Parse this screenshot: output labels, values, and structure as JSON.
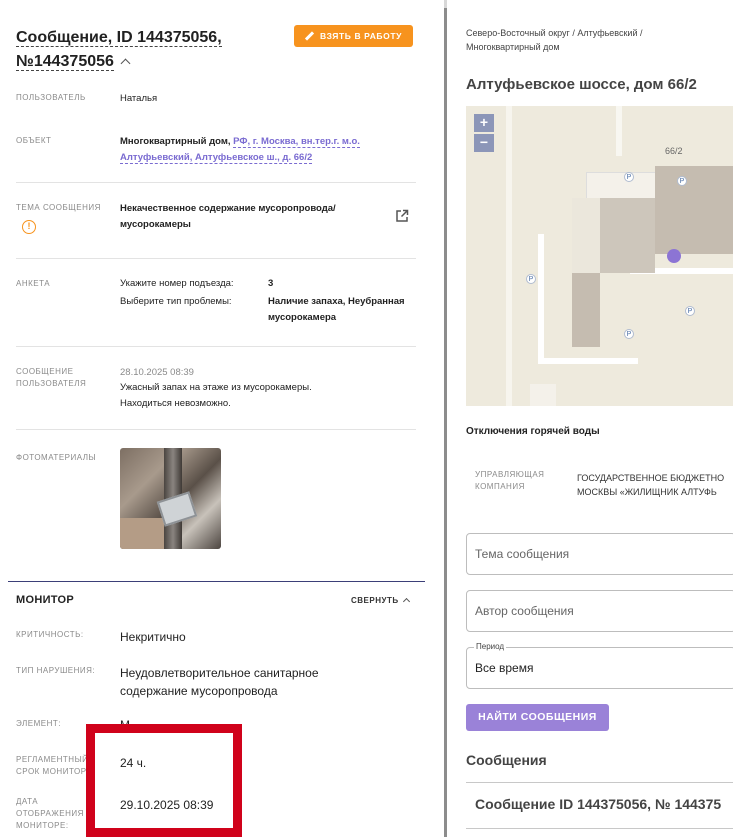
{
  "message": {
    "title_line1": "Сообщение, ID 144375056,",
    "title_line2": "№144375056",
    "take_button": "ВЗЯТЬ В РАБОТУ",
    "fields": {
      "user_label": "ПОЛЬЗОВАТЕЛЬ",
      "user_value": "Наталья",
      "object_label": "ОБЪЕКТ",
      "object_prefix": "Многоквартирный дом, ",
      "object_link_1": "РФ, г. Москва, вн.тер.г. м.о.",
      "object_link_2": "Алтуфьевский, Алтуфьевское ш., д. 66/2",
      "topic_label": "ТЕМА СООБЩЕНИЯ",
      "topic_value_1": "Некачественное содержание мусоропровода/",
      "topic_value_2": "мусорокамеры",
      "survey_label": "АНКЕТА",
      "survey_q1": "Укажите номер подъезда:",
      "survey_a1": "3",
      "survey_q2": "Выберите тип проблемы:",
      "survey_a2_1": "Наличие запаха, Неубранная",
      "survey_a2_2": "мусорокамера",
      "user_msg_label_1": "СООБЩЕНИЕ",
      "user_msg_label_2": "ПОЛЬЗОВАТЕЛЯ",
      "user_msg_date": "28.10.2025 08:39",
      "user_msg_text_1": "Ужасный запах на этаже из мусорокамеры.",
      "user_msg_text_2": "Находиться невозможно.",
      "photos_label": "ФОТОМАТЕРИАЛЫ"
    }
  },
  "monitor": {
    "title": "МОНИТОР",
    "collapse": "СВЕРНУТЬ",
    "criticality_label": "КРИТИЧНОСТЬ:",
    "criticality_value": "Некритично",
    "violation_label": "ТИП НАРУШЕНИЯ:",
    "violation_value_1": "Неудовлетворительное санитарное",
    "violation_value_2": "содержание мусоропровода",
    "element_label": "ЭЛЕМЕНТ:",
    "element_value": "М",
    "deadline_label_1": "РЕГЛАМЕНТНЫЙ",
    "deadline_label_2": "СРОК МОНИТОР",
    "deadline_value": "24 ч.",
    "display_date_label_1": "ДАТА",
    "display_date_label_2": "ОТОБРАЖЕНИЯ",
    "display_date_label_3": "МОНИТОРЕ:",
    "display_date_value": "29.10.2025 08:39"
  },
  "right": {
    "crumb_1": "Северо-Восточный округ / Алтуфьевский /",
    "crumb_2": "Многоквартирный дом",
    "address": "Алтуфьевское шоссе, дом 66/2",
    "map": {
      "zoom_in": "+",
      "zoom_out": "−",
      "house_number": "66/2",
      "parking": "P"
    },
    "notice": "Отключения горячей воды",
    "uk_label_1": "УПРАВЛЯЮЩАЯ",
    "uk_label_2": "КОМПАНИЯ",
    "uk_value_1": "ГОСУДАРСТВЕННОЕ БЮДЖЕТНО",
    "uk_value_2": "МОСКВЫ «ЖИЛИЩНИК АЛТУФЬ",
    "topic_placeholder": "Тема сообщения",
    "author_placeholder": "Автор сообщения",
    "period_label": "Период",
    "period_value": "Все время",
    "find_button": "НАЙТИ СООБЩЕНИЯ",
    "messages_heading": "Сообщения",
    "messages_item": "Сообщение ID 144375056, № 144375"
  },
  "colors": {
    "accent_orange": "#f7931e",
    "accent_purple": "#9a82d8",
    "link_purple": "#7a6bd1",
    "highlight_red": "#d0021b"
  },
  "icons": [
    "pencil-icon",
    "chevron-up-icon",
    "warning-circle-icon",
    "external-link-icon",
    "zoom-in-icon",
    "zoom-out-icon",
    "location-marker-icon",
    "parking-icon"
  ]
}
